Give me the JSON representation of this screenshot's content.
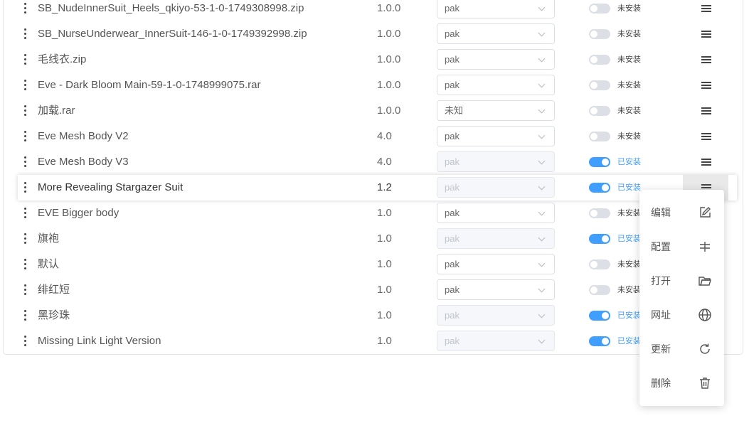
{
  "rows": [
    {
      "name": "SB_NudeInnerSuit_Heels_qkiyo-53-1-0-1749308998.zip",
      "version": "1.0.0",
      "type": "pak",
      "type_disabled": false,
      "enabled": false,
      "status": "未安装"
    },
    {
      "name": "SB_NurseUnderwear_InnerSuit-146-1-0-1749392998.zip",
      "version": "1.0.0",
      "type": "pak",
      "type_disabled": false,
      "enabled": false,
      "status": "未安装"
    },
    {
      "name": "毛线衣.zip",
      "version": "1.0.0",
      "type": "pak",
      "type_disabled": false,
      "enabled": false,
      "status": "未安装"
    },
    {
      "name": "Eve - Dark Bloom Main-59-1-0-1748999075.rar",
      "version": "1.0.0",
      "type": "pak",
      "type_disabled": false,
      "enabled": false,
      "status": "未安装"
    },
    {
      "name": "加载.rar",
      "version": "1.0.0",
      "type": "未知",
      "type_disabled": false,
      "enabled": false,
      "status": "未安装"
    },
    {
      "name": "Eve Mesh Body V2",
      "version": "4.0",
      "type": "pak",
      "type_disabled": false,
      "enabled": false,
      "status": "未安装"
    },
    {
      "name": "Eve Mesh Body V3",
      "version": "4.0",
      "type": "pak",
      "type_disabled": true,
      "enabled": true,
      "status": "已安装"
    },
    {
      "name": "More Revealing Stargazer Suit",
      "version": "1.2",
      "type": "pak",
      "type_disabled": true,
      "enabled": true,
      "status": "已安装",
      "selected": true
    },
    {
      "name": "EVE Bigger body",
      "version": "1.0",
      "type": "pak",
      "type_disabled": false,
      "enabled": false,
      "status": "未安装"
    },
    {
      "name": "旗袍",
      "version": "1.0",
      "type": "pak",
      "type_disabled": true,
      "enabled": true,
      "status": "已安装"
    },
    {
      "name": "默认",
      "version": "1.0",
      "type": "pak",
      "type_disabled": false,
      "enabled": false,
      "status": "未安装"
    },
    {
      "name": "绯红短",
      "version": "1.0",
      "type": "pak",
      "type_disabled": false,
      "enabled": false,
      "status": "未安装"
    },
    {
      "name": "黑珍珠",
      "version": "1.0",
      "type": "pak",
      "type_disabled": true,
      "enabled": true,
      "status": "已安装"
    },
    {
      "name": "Missing Link Light Version",
      "version": "1.0",
      "type": "pak",
      "type_disabled": true,
      "enabled": true,
      "status": "已安装"
    }
  ],
  "context_menu": {
    "items": [
      {
        "label": "编辑",
        "icon": "edit-icon"
      },
      {
        "label": "配置",
        "icon": "settings-sliders-icon"
      },
      {
        "label": "打开",
        "icon": "folder-open-icon"
      },
      {
        "label": "网址",
        "icon": "globe-icon"
      },
      {
        "label": "更新",
        "icon": "refresh-icon"
      },
      {
        "label": "删除",
        "icon": "trash-icon"
      }
    ]
  },
  "colors": {
    "accent": "#409eff",
    "toggle_off": "#dcdfe6",
    "selected_menu_button": "#e9e9e9"
  }
}
